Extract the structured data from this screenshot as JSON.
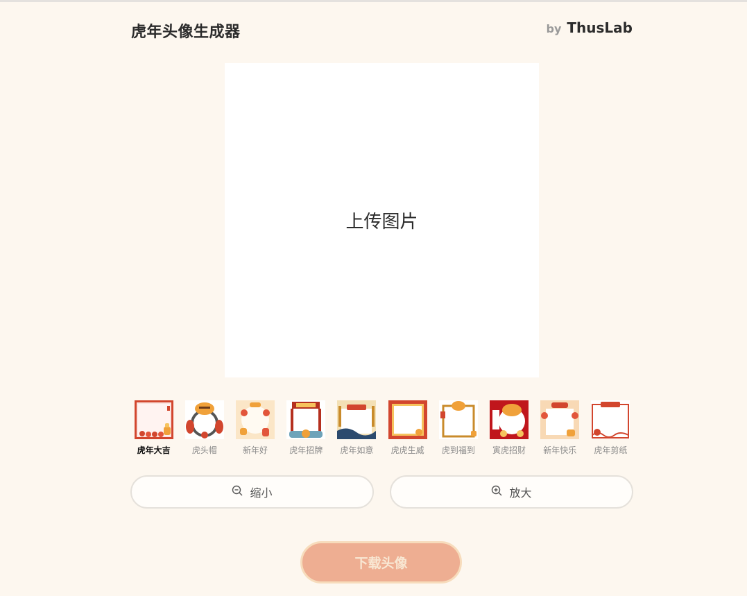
{
  "header": {
    "title": "虎年头像生成器",
    "by": "by",
    "brand": "ThusLab"
  },
  "canvas": {
    "upload_label": "上传图片"
  },
  "frames": [
    {
      "label": "虎年大吉",
      "icon": "frame-hunian-daji",
      "selected": true
    },
    {
      "label": "虎头帽",
      "icon": "frame-hutou-mao",
      "selected": false
    },
    {
      "label": "新年好",
      "icon": "frame-xinnian-hao",
      "selected": false
    },
    {
      "label": "虎年招牌",
      "icon": "frame-hunian-zhaopai",
      "selected": false
    },
    {
      "label": "虎年如意",
      "icon": "frame-hunian-ruyi",
      "selected": false
    },
    {
      "label": "虎虎生威",
      "icon": "frame-huhu-shengwei",
      "selected": false
    },
    {
      "label": "虎到福到",
      "icon": "frame-hudao-fudao",
      "selected": false
    },
    {
      "label": "寅虎招财",
      "icon": "frame-yinhu-zhaocai",
      "selected": false
    },
    {
      "label": "新年快乐",
      "icon": "frame-xinnian-kuaile",
      "selected": false
    },
    {
      "label": "虎年剪纸",
      "icon": "frame-hunian-jianzhi",
      "selected": false
    }
  ],
  "zoom": {
    "out_label": "缩小",
    "in_label": "放大"
  },
  "download": {
    "label": "下载头像"
  },
  "colors": {
    "background": "#fdf7ef",
    "accent": "#d2462e",
    "download": "#eeae92"
  }
}
